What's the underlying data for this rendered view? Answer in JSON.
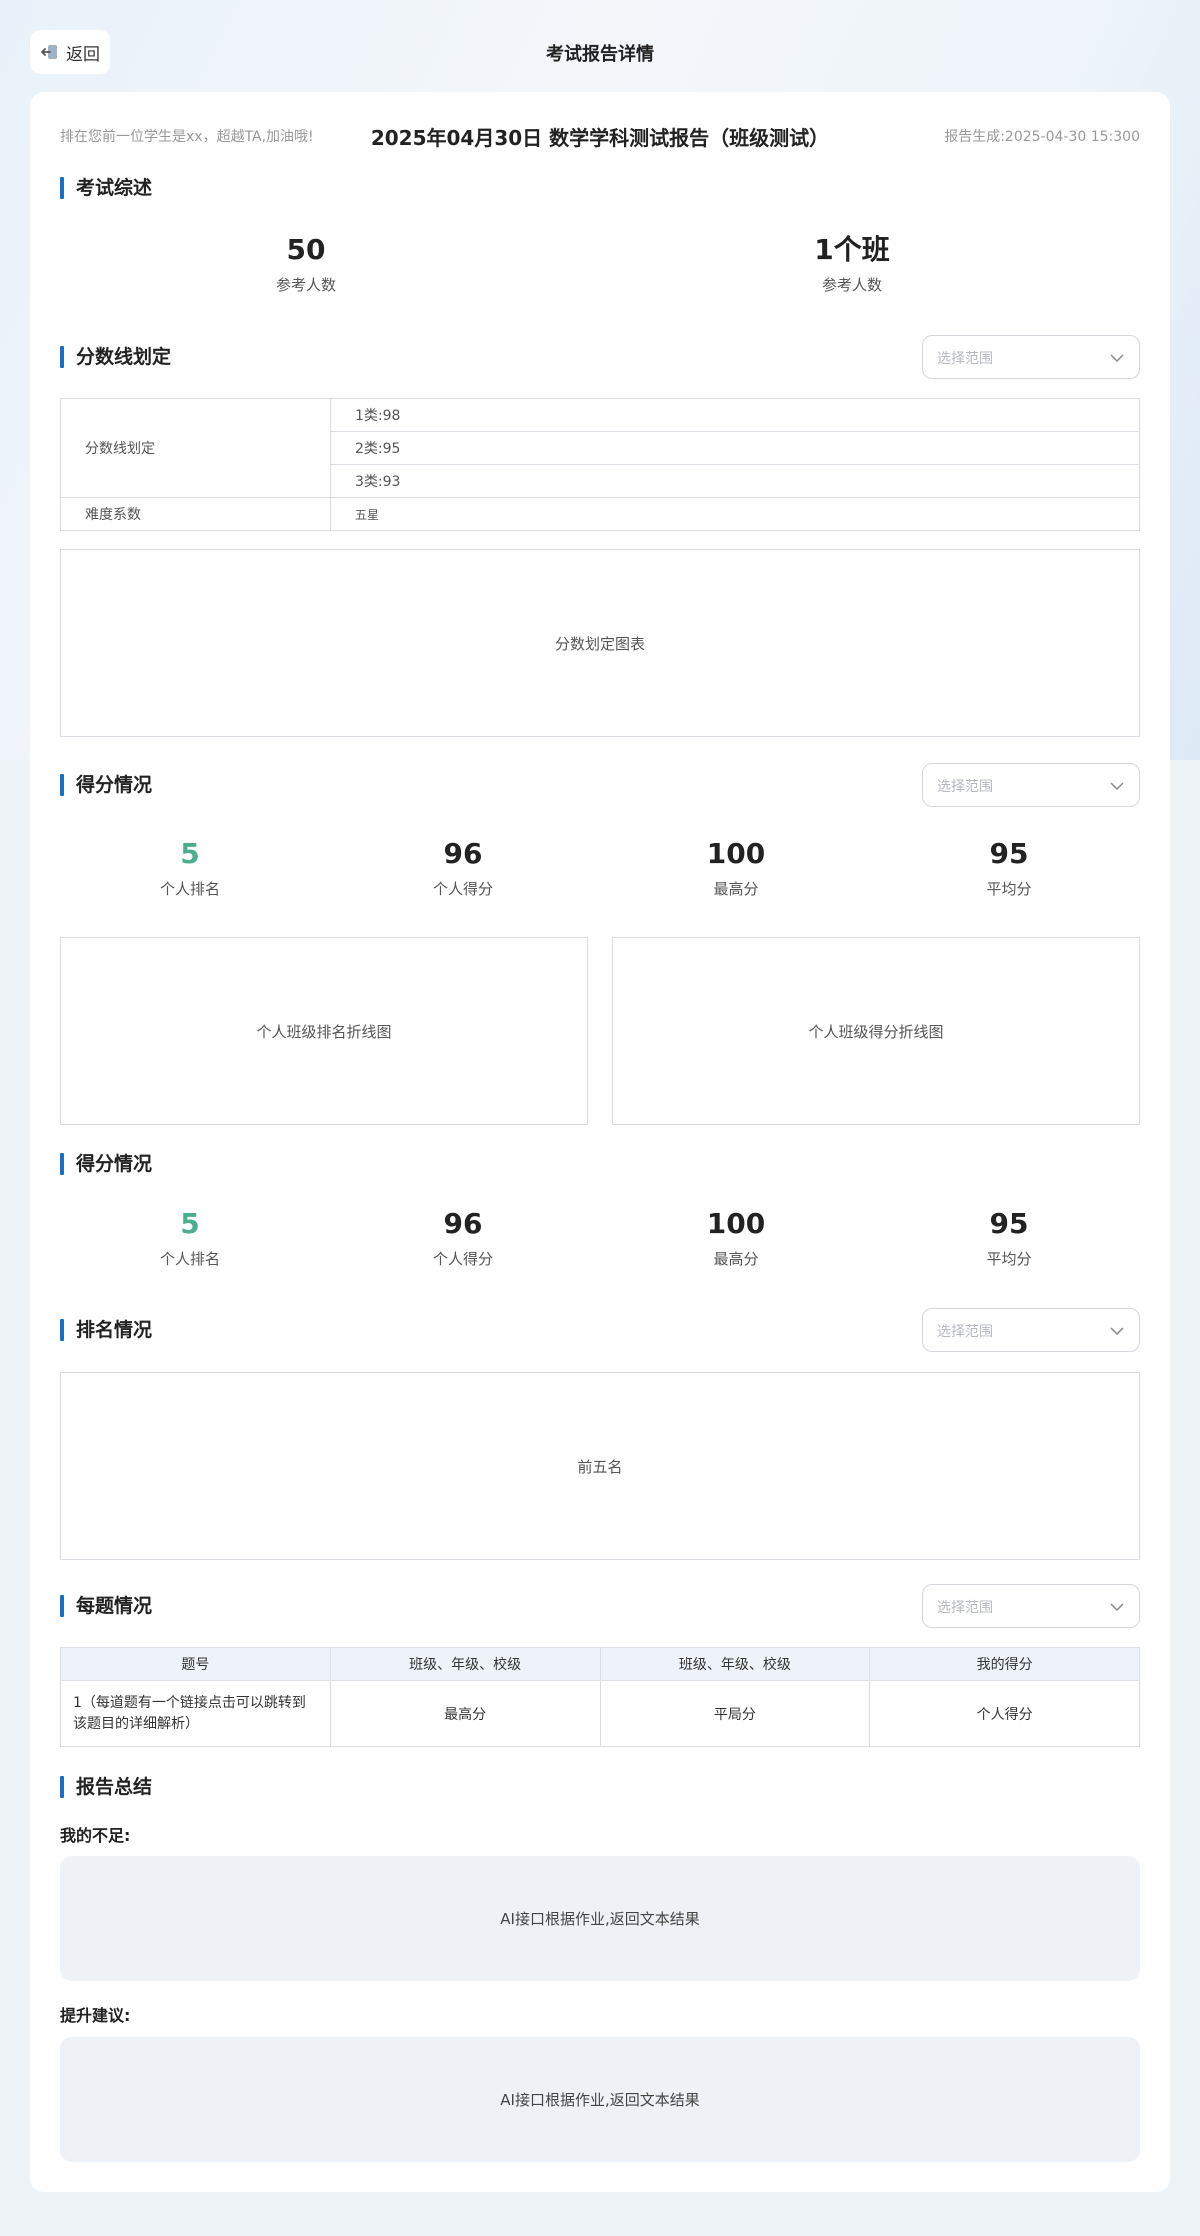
{
  "topbar": {
    "back_label": "返回",
    "title": "考试报告详情"
  },
  "header": {
    "left_note": "排在您前一位学生是xx，超越TA,加油哦!",
    "report_title": "2025年04月30日 数学学科测试报告（班级测试）",
    "generated": "报告生成:2025-04-30 15:300"
  },
  "overview": {
    "title": "考试综述",
    "stats": [
      {
        "value": "50",
        "label": "参考人数"
      },
      {
        "value": "1个班",
        "label": "参考人数"
      }
    ]
  },
  "score_line": {
    "title": "分数线划定",
    "select_placeholder": "选择范围",
    "row_label": "分数线划定",
    "lines": [
      "1类:98",
      "2类:95",
      "3类:93"
    ],
    "difficulty_label": "难度系数",
    "difficulty_value": "五星",
    "chart_placeholder": "分数划定图表"
  },
  "score_situation_1": {
    "title": "得分情况",
    "select_placeholder": "选择范围",
    "stats": [
      {
        "value": "5",
        "label": "个人排名"
      },
      {
        "value": "96",
        "label": "个人得分"
      },
      {
        "value": "100",
        "label": "最高分"
      },
      {
        "value": "95",
        "label": "平均分"
      }
    ],
    "chart_left": "个人班级排名折线图",
    "chart_right": "个人班级得分折线图"
  },
  "score_situation_2": {
    "title": "得分情况",
    "stats": [
      {
        "value": "5",
        "label": "个人排名"
      },
      {
        "value": "96",
        "label": "个人得分"
      },
      {
        "value": "100",
        "label": "最高分"
      },
      {
        "value": "95",
        "label": "平均分"
      }
    ]
  },
  "ranking": {
    "title": "排名情况",
    "select_placeholder": "选择范围",
    "chart_placeholder": "前五名"
  },
  "per_question": {
    "title": "每题情况",
    "select_placeholder": "选择范围",
    "headers": [
      "题号",
      "班级、年级、校级",
      "班级、年级、校级",
      "我的得分"
    ],
    "rows": [
      [
        "1（每道题有一个链接点击可以跳转到该题目的详细解析）",
        "最高分",
        "平局分",
        "个人得分"
      ]
    ]
  },
  "summary": {
    "title": "报告总结",
    "weakness_label": "我的不足:",
    "weakness_text": "AI接口根据作业,返回文本结果",
    "advice_label": "提升建议:",
    "advice_text": "AI接口根据作业,返回文本结果"
  },
  "colors": {
    "accent": "#1a6fc2",
    "rank_green": "#4caf8b",
    "page_bg": "#eef3f8"
  }
}
